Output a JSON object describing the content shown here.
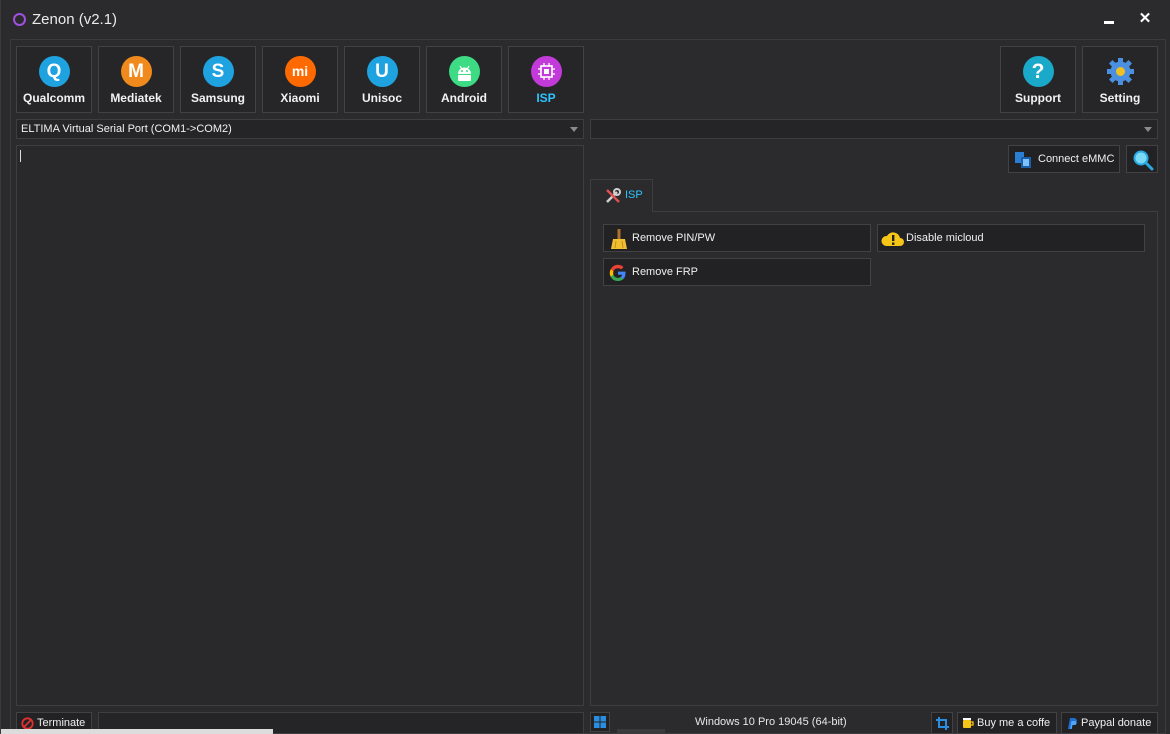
{
  "window": {
    "title": "Zenon (v2.1)",
    "minimize": "",
    "close": "✕"
  },
  "toolbar": {
    "tools": [
      {
        "label": "Qualcomm",
        "glyph": "Q",
        "color": "#1fa3e0"
      },
      {
        "label": "Mediatek",
        "glyph": "M",
        "color": "#f08a1c"
      },
      {
        "label": "Samsung",
        "glyph": "S",
        "color": "#1fa3e0"
      },
      {
        "label": "Xiaomi",
        "glyph": "mi",
        "color": "#ff6a00"
      },
      {
        "label": "Unisoc",
        "glyph": "U",
        "color": "#1fa3e0"
      },
      {
        "label": "Android",
        "glyph": "",
        "color": "#3ddc84"
      },
      {
        "label": "ISP",
        "glyph": "",
        "color": "#c23ad9"
      }
    ],
    "support": {
      "label": "Support",
      "glyph": "?",
      "color": "#1aa9c8"
    },
    "setting": {
      "label": "Setting"
    }
  },
  "ports": {
    "left_selected": "ELTIMA Virtual Serial Port (COM1->COM2)",
    "right_selected": ""
  },
  "actions": {
    "connect_label": "Connect eMMC",
    "tab_label": "ISP",
    "remove_pin": "Remove PIN/PW",
    "disable_micloud": "Disable micloud",
    "remove_frp": "Remove FRP"
  },
  "footer": {
    "terminate": "Terminate",
    "os": "Windows 10 Pro 19045 (64-bit)",
    "coffee": "Buy me a coffe",
    "paypal": "Paypal donate"
  },
  "colors": {
    "accent": "#2ec4ff",
    "background": "#2b2b2d",
    "border": "#3e3e40"
  }
}
